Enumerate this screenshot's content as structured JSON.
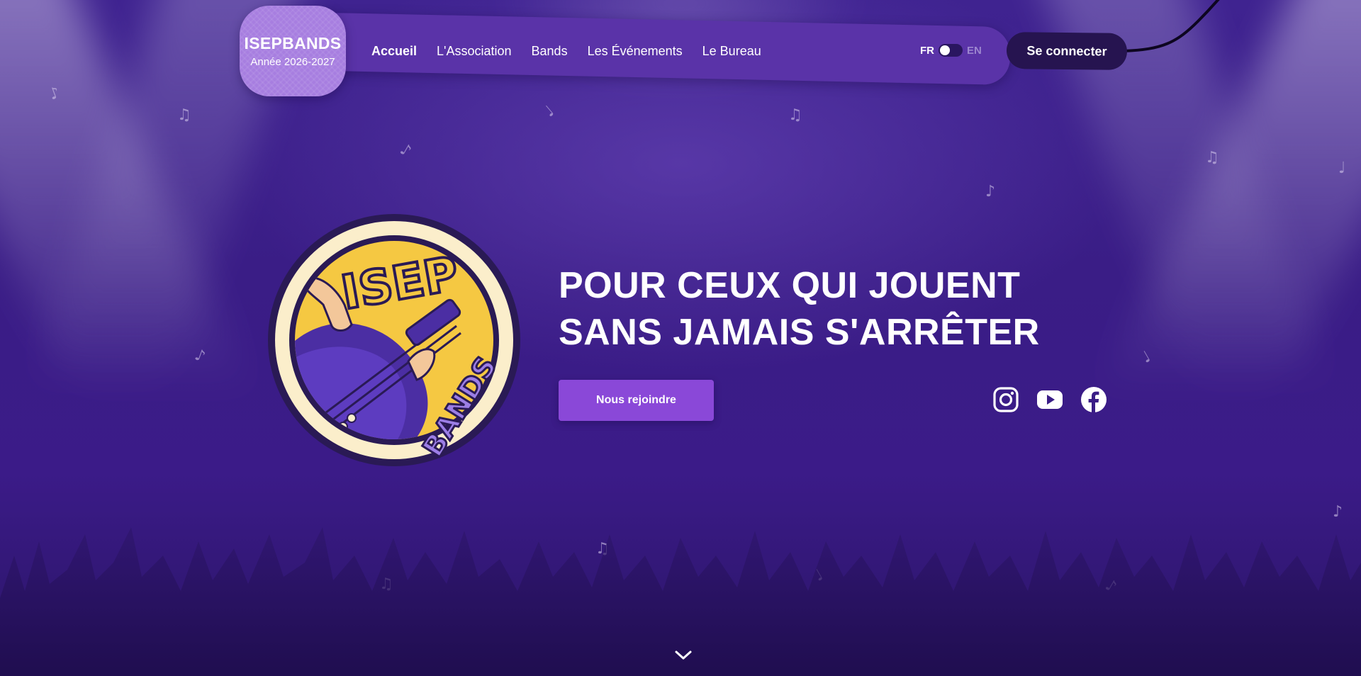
{
  "brand": {
    "name": "ISEPBANDS",
    "year_label": "Année 2026-2027"
  },
  "nav": {
    "items": [
      {
        "label": "Accueil",
        "active": true
      },
      {
        "label": "L'Association",
        "active": false
      },
      {
        "label": "Bands",
        "active": false
      },
      {
        "label": "Les Événements",
        "active": false
      },
      {
        "label": "Le Bureau",
        "active": false
      }
    ],
    "language": {
      "current": "FR",
      "other": "EN"
    },
    "login_label": "Se connecter"
  },
  "hero": {
    "title_line_1": "POUR CEUX QUI JOUENT",
    "title_line_2": "SANS JAMAIS S'ARRÊTER",
    "cta_label": "Nous rejoindre",
    "logo": {
      "top_text": "ISEP",
      "bottom_text": "BANDS"
    }
  },
  "socials": [
    {
      "icon": "instagram-icon"
    },
    {
      "icon": "youtube-icon"
    },
    {
      "icon": "facebook-icon"
    }
  ],
  "colors": {
    "background": "#3a1d86",
    "nav": "#5a33a8",
    "badge": "#a77ee0",
    "button": "#8a48d8",
    "login": "#261450",
    "logo_yellow": "#f5c842",
    "logo_purple": "#4b2ea3",
    "logo_ring": "#fbeecb"
  },
  "scroll_indicator_icon": "chevron-down-icon"
}
